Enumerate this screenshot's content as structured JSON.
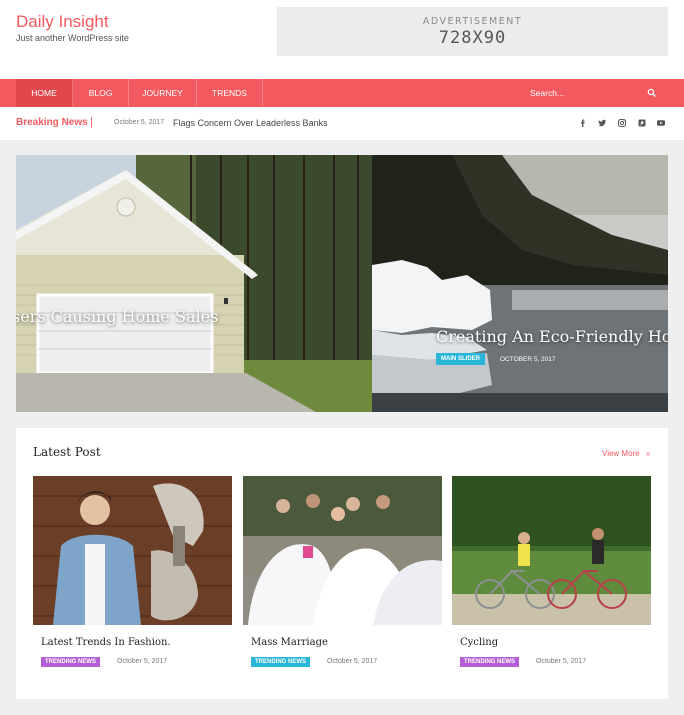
{
  "site": {
    "title": "Daily Insight",
    "tagline": "Just another WordPress site"
  },
  "ad": {
    "label": "ADVERTISEMENT",
    "size": "728X90"
  },
  "nav": {
    "items": [
      {
        "label": "HOME",
        "active": true
      },
      {
        "label": "BLOG",
        "active": false
      },
      {
        "label": "JOURNEY",
        "active": false
      },
      {
        "label": "TRENDS",
        "active": false
      }
    ],
    "search_placeholder": "Search..."
  },
  "breaking": {
    "label": "Breaking News",
    "separator": "|",
    "date": "October 5, 2017",
    "headline": "Flags Concern Over Leaderless Banks"
  },
  "social_icons": [
    "facebook-icon",
    "twitter-icon",
    "instagram-icon",
    "pinterest-icon",
    "youtube-icon"
  ],
  "slider": {
    "slides": [
      {
        "title": "sers Causing Home Sales"
      },
      {
        "title": "Creating An Eco-Friendly Hol",
        "tag": "MAIN SLIDER",
        "date": "OCTOBER 5, 2017"
      }
    ]
  },
  "latest": {
    "title": "Latest Post",
    "view_more": "View More",
    "posts": [
      {
        "title": "Latest Trends In Fashion.",
        "tag": "TRENDING NEWS",
        "tag_color": "#b55fd6",
        "date": "October 5, 2017"
      },
      {
        "title": "Mass Marriage",
        "tag": "TRENDING NEWS",
        "tag_color": "#29b6d8",
        "date": "October 5, 2017"
      },
      {
        "title": "Cycling",
        "tag": "TRENDING NEWS",
        "tag_color": "#b55fd6",
        "date": "October 5, 2017"
      }
    ]
  },
  "colors": {
    "accent": "#f25a5f",
    "nav_active": "#e0474d"
  }
}
